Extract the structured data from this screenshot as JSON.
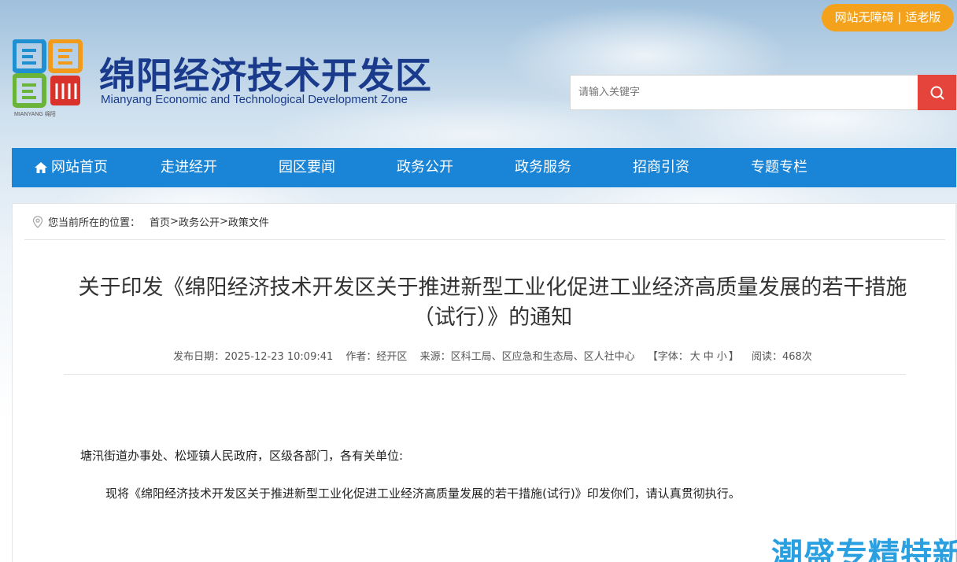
{
  "header": {
    "accessibility_label": "网站无障碍",
    "accessibility_sep": "|",
    "elder_label": "适老版",
    "site_title": "绵阳经济技术开发区",
    "site_subtitle": "Mianyang Economic and Technological Development Zone",
    "logo_text": "MIANYANG 绵阳",
    "search_placeholder": "请输入关键字",
    "search_icon": "search-icon"
  },
  "nav": {
    "items": [
      {
        "label": "网站首页",
        "icon": "home-icon"
      },
      {
        "label": "走进经开"
      },
      {
        "label": "园区要闻"
      },
      {
        "label": "政务公开"
      },
      {
        "label": "政务服务"
      },
      {
        "label": "招商引资"
      },
      {
        "label": "专题专栏"
      }
    ]
  },
  "breadcrumb": {
    "prefix": "您当前所在的位置：",
    "items": [
      "首页",
      "政务公开",
      "政策文件"
    ],
    "separator": ">"
  },
  "article": {
    "title": "关于印发《绵阳经济技术开发区关于推进新型工业化促进工业经济高质量发展的若干措施（试行）》的通知",
    "meta": {
      "date_label": "发布日期：",
      "date": "2025-12-23 10:09:41",
      "author_label": "作者：",
      "author": "经开区",
      "source_label": "来源：",
      "source": "区科工局、区应急和生态局、区人社中心",
      "font_label": "【字体：",
      "font_large": "大",
      "font_medium": "中",
      "font_small": "小",
      "font_close": "】",
      "views_label": "阅读：",
      "views": "468次"
    },
    "salutation": "塘汛街道办事处、松垭镇人民政府，区级各部门，各有关单位:",
    "body": "现将《绵阳经济技术开发区关于推进新型工业化促进工业经济高质量发展的若干措施(试行)》印发你们，请认真贯彻执行。"
  },
  "watermark": "潮盛专精特新",
  "colors": {
    "nav": "#1a84d6",
    "accent_orange": "#f4a21c",
    "search_red": "#e4443b",
    "title_blue": "#1a3a8c",
    "watermark": "#2aa0e0"
  }
}
